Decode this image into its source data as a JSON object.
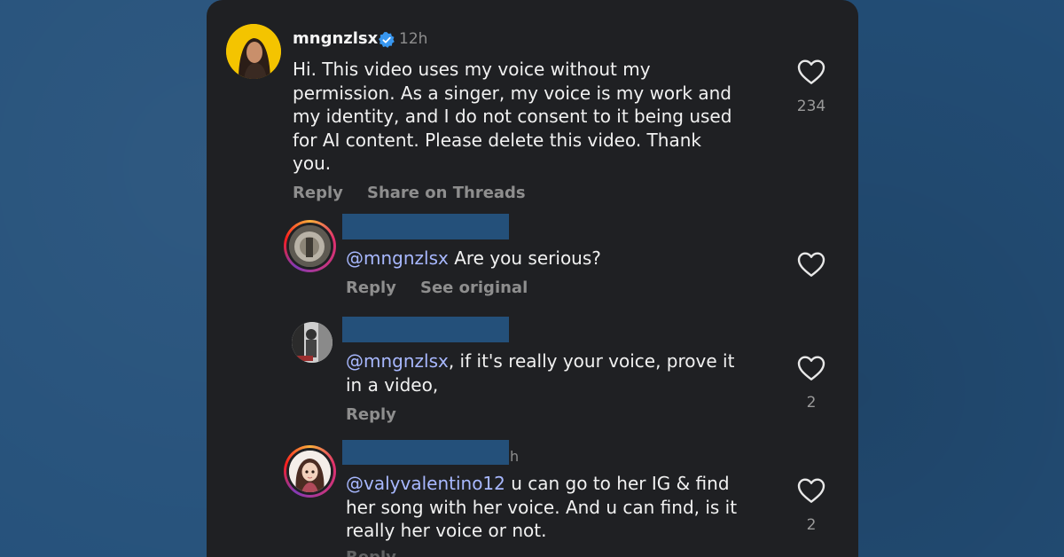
{
  "comments": [
    {
      "username": "mngnzlsx",
      "time": "12h",
      "text": "Hi. This video uses my voice without my permission. As a singer, my voice is my work and my identity, and I do not consent to it being used for AI content. Please delete this video. Thank you.",
      "text_lines": [
        "Hi. This video uses my voice without my",
        "permission. As a singer, my voice is my work and",
        "my identity, and I do not consent to it being used",
        "for AI content. Please delete this video. Thank",
        "you."
      ],
      "likes": "234",
      "actions": [
        "Reply",
        "Share on Threads"
      ]
    },
    {
      "mention": "@mngnzlsx",
      "text": " Are you serious?",
      "actions": [
        "Reply",
        "See original"
      ]
    },
    {
      "mention": "@mngnzlsx",
      "text_line1": ", if it's really your voice, prove it",
      "text_line2": "in a video,",
      "likes": "2",
      "actions": [
        "Reply"
      ]
    },
    {
      "time_suffix": "h",
      "mention": "@valyvalentino12",
      "text_line1": " u can go to her IG & find",
      "text_line2": "her song with her voice. And u can find, is it",
      "text_line3": "really her voice or not.",
      "likes": "2",
      "actions": [
        "Reply"
      ]
    }
  ],
  "icons": {
    "verified": "verified-badge-icon",
    "like": "heart-outline-icon"
  },
  "colors": {
    "background": "#24507a",
    "panel": "#1f2023",
    "mention": "#a8b8ff",
    "muted": "#8e8e8e",
    "verified": "#3897f0"
  }
}
